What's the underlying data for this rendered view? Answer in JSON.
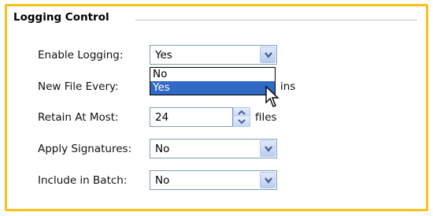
{
  "group": {
    "title": "Logging Control"
  },
  "rows": {
    "enable_logging": {
      "label": "Enable Logging:",
      "value": "Yes"
    },
    "new_file_every": {
      "label": "New File Every:",
      "suffix": "ins"
    },
    "retain_at_most": {
      "label": "Retain At Most:",
      "value": "24",
      "suffix": "files"
    },
    "apply_signatures": {
      "label": "Apply Signatures:",
      "value": "No"
    },
    "include_in_batch": {
      "label": "Include in Batch:",
      "value": "No"
    }
  },
  "dropdown_list": {
    "options": [
      "No",
      "Yes"
    ],
    "selected": "Yes"
  },
  "colors": {
    "frame_border": "#f6c21a",
    "selection": "#316ac5",
    "field_border": "#7f9db9"
  }
}
